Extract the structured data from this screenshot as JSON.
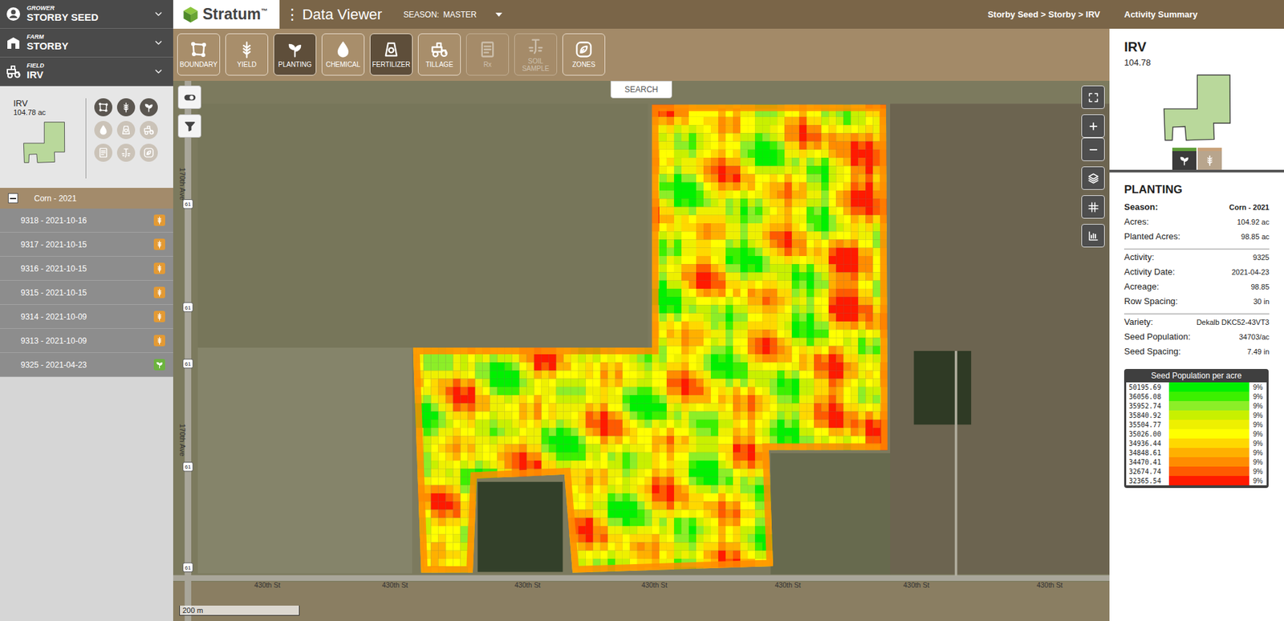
{
  "sidebar": {
    "selectors": [
      {
        "caption": "GROWER",
        "value": "STORBY SEED",
        "kind": "person"
      },
      {
        "caption": "FARM",
        "value": "STORBY",
        "kind": "farm"
      },
      {
        "caption": "FIELD",
        "value": "IRV",
        "kind": "field"
      }
    ],
    "field": {
      "name": "IRV",
      "area": "104.78 ac",
      "layers": [
        {
          "kind": "boundary",
          "enabled": true
        },
        {
          "kind": "yield",
          "enabled": true
        },
        {
          "kind": "planting",
          "enabled": true
        },
        {
          "kind": "chemical",
          "enabled": false
        },
        {
          "kind": "fertilizer",
          "enabled": false
        },
        {
          "kind": "tillage",
          "enabled": false
        },
        {
          "kind": "rx",
          "enabled": false
        },
        {
          "kind": "soil",
          "enabled": false
        },
        {
          "kind": "zones",
          "enabled": false
        }
      ]
    },
    "season_group": {
      "label": "Corn - 2021",
      "expanded": true
    },
    "activities": [
      {
        "label": "9318 - 2021-10-16",
        "kind": "yield"
      },
      {
        "label": "9317 - 2021-10-15",
        "kind": "yield"
      },
      {
        "label": "9316 - 2021-10-15",
        "kind": "yield"
      },
      {
        "label": "9315 - 2021-10-15",
        "kind": "yield"
      },
      {
        "label": "9314 - 2021-10-09",
        "kind": "yield"
      },
      {
        "label": "9313 - 2021-10-09",
        "kind": "yield"
      },
      {
        "label": "9325 - 2021-04-23",
        "kind": "planting"
      }
    ]
  },
  "topbar": {
    "logo": "Stratum",
    "trademark": "™",
    "menu_glyph": "⋮",
    "app": "Data Viewer",
    "season_label": "SEASON:",
    "season_value": "MASTER",
    "breadcrumb": "Storby Seed > Storby > IRV"
  },
  "toolbar": [
    {
      "label": "BOUNDARY",
      "kind": "boundary",
      "active": false,
      "disabled": false
    },
    {
      "label": "YIELD",
      "kind": "yield",
      "active": false,
      "disabled": false
    },
    {
      "label": "PLANTING",
      "kind": "planting",
      "active": true,
      "disabled": false
    },
    {
      "label": "CHEMICAL",
      "kind": "chemical",
      "active": false,
      "disabled": false
    },
    {
      "label": "FERTILIZER",
      "kind": "fertilizer",
      "active": true,
      "disabled": false
    },
    {
      "label": "TILLAGE",
      "kind": "tillage",
      "active": false,
      "disabled": false
    },
    {
      "label": "Rx",
      "kind": "rx",
      "active": false,
      "disabled": true
    },
    {
      "label": "SOIL SAMPLE",
      "kind": "soil",
      "active": false,
      "disabled": true
    },
    {
      "label": "ZONES",
      "kind": "zones",
      "active": false,
      "disabled": false
    }
  ],
  "map": {
    "search": "SEARCH",
    "road_labels": [
      "170th Ave",
      "170th Ave"
    ],
    "street_labels": [
      "430th St",
      "430th St",
      "430th St",
      "430th St",
      "430th St",
      "430th St",
      "430th St"
    ],
    "shields": [
      "61",
      "61",
      "61",
      "61",
      "61"
    ],
    "scale": "200 m"
  },
  "summary": {
    "title": "Activity Summary",
    "field": "IRV",
    "area": "104.78",
    "tabs": [
      {
        "kind": "planting",
        "selected": true,
        "color": "#5f9e3a"
      },
      {
        "kind": "yield",
        "selected": false,
        "color": "#c9a27a"
      }
    ],
    "section": "PLANTING",
    "groups": [
      [
        {
          "label": "Season:",
          "value": "Corn - 2021",
          "bold": true
        },
        {
          "label": "Acres:",
          "value": "104.92 ac",
          "bold": false
        },
        {
          "label": "Planted Acres:",
          "value": "98.85 ac",
          "bold": false
        }
      ],
      [
        {
          "label": "Activity:",
          "value": "9325",
          "bold": false
        },
        {
          "label": "Activity Date:",
          "value": "2021-04-23",
          "bold": false
        },
        {
          "label": "Acreage:",
          "value": "98.85",
          "bold": false
        },
        {
          "label": "Row Spacing:",
          "value": "30 in",
          "bold": false
        }
      ],
      [
        {
          "label": "Variety:",
          "value": "Dekalb DKC52-43VT3",
          "bold": false
        },
        {
          "label": "Seed Population:",
          "value": "34703/ac",
          "bold": false
        },
        {
          "label": "Seed Spacing:",
          "value": "7.49 in",
          "bold": false
        }
      ]
    ],
    "legend": {
      "title": "Seed Population per acre",
      "rows": [
        {
          "value": "50195.69",
          "share": "9%",
          "color": "#00f000"
        },
        {
          "value": "36056.08",
          "share": "9%",
          "color": "#3cf000"
        },
        {
          "value": "35952.74",
          "share": "9%",
          "color": "#8cee28"
        },
        {
          "value": "35840.92",
          "share": "9%",
          "color": "#c8f000"
        },
        {
          "value": "35504.77",
          "share": "9%",
          "color": "#eef000"
        },
        {
          "value": "35026.00",
          "share": "9%",
          "color": "#ffff00"
        },
        {
          "value": "34936.44",
          "share": "9%",
          "color": "#ffd800"
        },
        {
          "value": "34848.61",
          "share": "9%",
          "color": "#ffb000"
        },
        {
          "value": "34470.41",
          "share": "9%",
          "color": "#ff8c00"
        },
        {
          "value": "32674.74",
          "share": "9%",
          "color": "#ff5a00"
        },
        {
          "value": "32365.54",
          "share": "9%",
          "color": "#ff1a00"
        }
      ]
    }
  }
}
